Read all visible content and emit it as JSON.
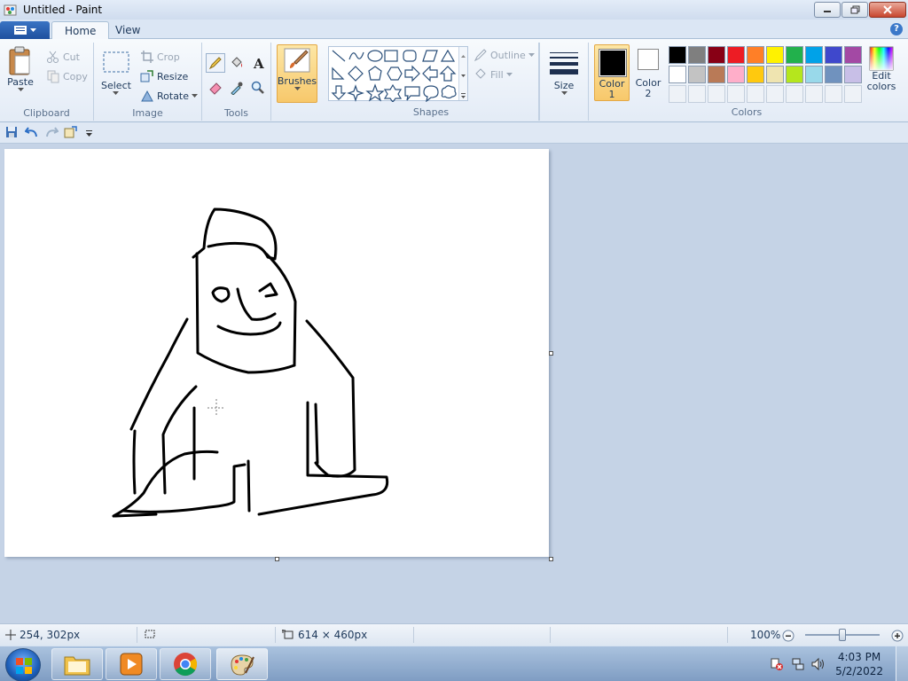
{
  "window": {
    "title": "Untitled - Paint"
  },
  "tabs": {
    "home": "Home",
    "view": "View"
  },
  "ribbon": {
    "clipboard": {
      "label": "Clipboard",
      "paste": "Paste",
      "cut": "Cut",
      "copy": "Copy"
    },
    "image": {
      "label": "Image",
      "select": "Select",
      "crop": "Crop",
      "resize": "Resize",
      "rotate": "Rotate"
    },
    "tools": {
      "label": "Tools"
    },
    "brushes": {
      "label": "Brushes"
    },
    "shapes": {
      "label": "Shapes",
      "outline": "Outline",
      "fill": "Fill"
    },
    "size": {
      "label": "Size"
    },
    "colors": {
      "label": "Colors",
      "color1": "Color",
      "color1_num": "1",
      "color2": "Color",
      "color2_num": "2",
      "edit": "Edit",
      "edit2": "colors",
      "palette_row1": [
        "#000000",
        "#7f7f7f",
        "#880015",
        "#ed1c24",
        "#ff7f27",
        "#fff200",
        "#22b14c",
        "#00a2e8",
        "#3f48cc",
        "#a349a4"
      ],
      "palette_row2": [
        "#ffffff",
        "#c3c3c3",
        "#b97a57",
        "#ffaec9",
        "#ffc90e",
        "#efe4b0",
        "#b5e61d",
        "#99d9ea",
        "#7092be",
        "#c8bfe7"
      ]
    }
  },
  "status": {
    "cursor_pos": "254, 302px",
    "canvas_size": "614 × 460px",
    "zoom": "100%"
  },
  "taskbar": {
    "time": "4:03 PM",
    "date": "5/2/2022"
  }
}
